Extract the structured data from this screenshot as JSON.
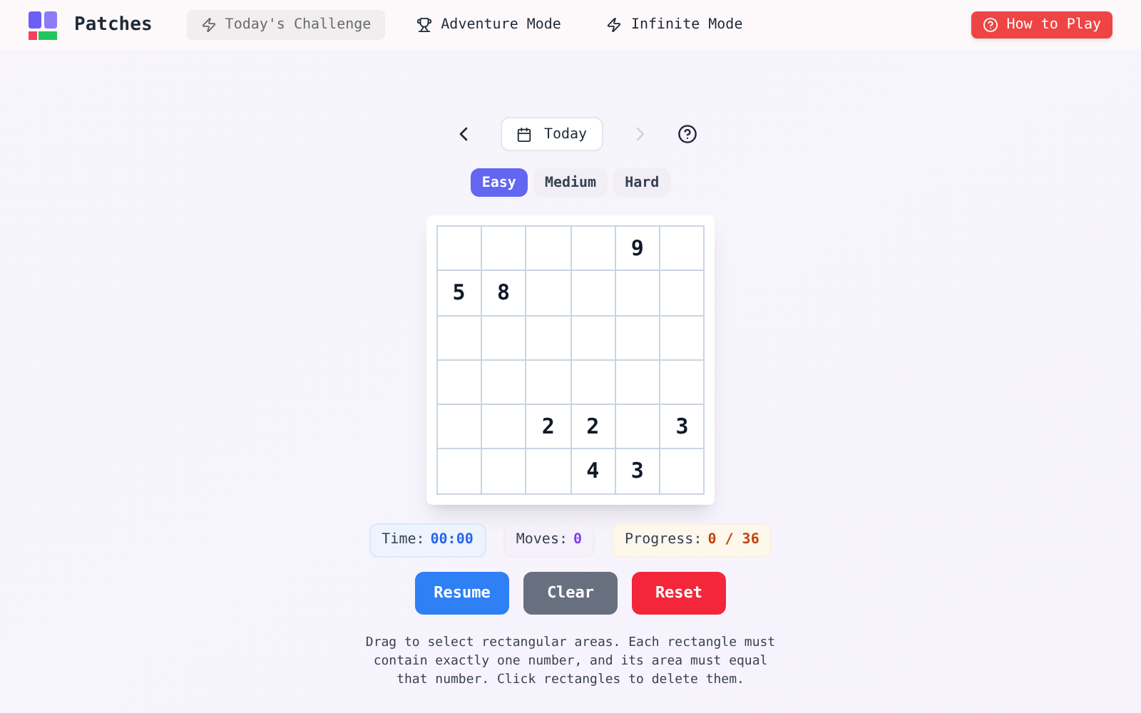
{
  "header": {
    "brand": "Patches",
    "nav": [
      {
        "label": "Today's Challenge",
        "selected": true
      },
      {
        "label": "Adventure Mode",
        "selected": false
      },
      {
        "label": "Infinite Mode",
        "selected": false
      }
    ],
    "help_button": "How to Play"
  },
  "date_nav": {
    "label": "Today",
    "next_disabled": true
  },
  "difficulty": [
    {
      "label": "Easy",
      "selected": true
    },
    {
      "label": "Medium",
      "selected": false
    },
    {
      "label": "Hard",
      "selected": false
    }
  ],
  "grid": [
    [
      {
        "kind": "blank"
      },
      {
        "kind": "blank"
      },
      {
        "kind": "blank"
      },
      {
        "kind": "blank"
      },
      {
        "kind": "clue",
        "number": "9"
      },
      {
        "kind": "blank"
      }
    ],
    [
      {
        "kind": "clue",
        "number": "5"
      },
      {
        "kind": "clue",
        "number": "8"
      },
      {
        "kind": "blank"
      },
      {
        "kind": "blank"
      },
      {
        "kind": "blank"
      },
      {
        "kind": "blank"
      }
    ],
    [
      {
        "kind": "blank"
      },
      {
        "kind": "blank"
      },
      {
        "kind": "blank"
      },
      {
        "kind": "blank"
      },
      {
        "kind": "blank"
      },
      {
        "kind": "blank"
      }
    ],
    [
      {
        "kind": "blank"
      },
      {
        "kind": "blank"
      },
      {
        "kind": "blank"
      },
      {
        "kind": "blank"
      },
      {
        "kind": "blank"
      },
      {
        "kind": "blank"
      }
    ],
    [
      {
        "kind": "blank"
      },
      {
        "kind": "blank"
      },
      {
        "kind": "clue",
        "number": "2"
      },
      {
        "kind": "clue",
        "number": "2"
      },
      {
        "kind": "blank"
      },
      {
        "kind": "clue",
        "number": "3"
      }
    ],
    [
      {
        "kind": "blank"
      },
      {
        "kind": "blank"
      },
      {
        "kind": "blank"
      },
      {
        "kind": "clue",
        "number": "4"
      },
      {
        "kind": "clue",
        "number": "3"
      },
      {
        "kind": "blank"
      }
    ]
  ],
  "stats": [
    {
      "label": "Time:",
      "value": "00:00",
      "kind": "time"
    },
    {
      "label": "Moves:",
      "value": "0",
      "kind": "moves"
    },
    {
      "label": "Progress:",
      "value": "0 / 36",
      "kind": "progress"
    }
  ],
  "buttons": [
    {
      "label": "Resume",
      "kind": "primary"
    },
    {
      "label": "Clear",
      "kind": "secondary"
    },
    {
      "label": "Reset",
      "kind": "danger"
    }
  ],
  "instructions": "Drag to select rectangular areas. Each rectangle must contain exactly one number, and its area must equal that number. Click rectangles to delete them."
}
